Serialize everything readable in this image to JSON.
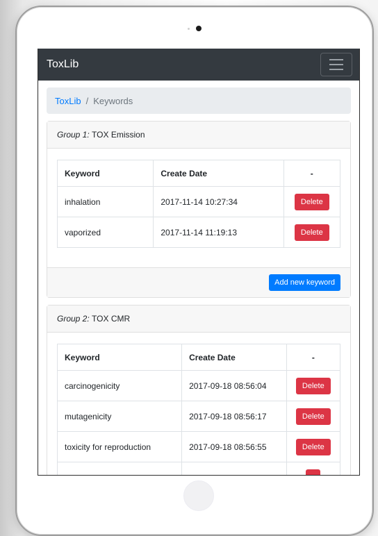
{
  "navbar": {
    "brand": "ToxLib",
    "toggle_icon": "hamburger-icon"
  },
  "breadcrumb": {
    "root": "ToxLib",
    "separator": "/",
    "current": "Keywords"
  },
  "groups": [
    {
      "label_prefix": "Group 1:",
      "name": "TOX Emission",
      "columns": [
        "Keyword",
        "Create Date",
        "-"
      ],
      "rows": [
        {
          "keyword": "inhalation",
          "date": "2017-11-14 10:27:34",
          "action": "Delete"
        },
        {
          "keyword": "vaporized",
          "date": "2017-11-14 11:19:13",
          "action": "Delete"
        }
      ],
      "footer_button": "Add new keyword"
    },
    {
      "label_prefix": "Group 2:",
      "name": "TOX CMR",
      "columns": [
        "Keyword",
        "Create Date",
        "-"
      ],
      "rows": [
        {
          "keyword": "carcinogenicity",
          "date": "2017-09-18 08:56:04",
          "action": "Delete"
        },
        {
          "keyword": "mutagenicity",
          "date": "2017-09-18 08:56:17",
          "action": "Delete"
        },
        {
          "keyword": "toxicity for reproduction",
          "date": "2017-09-18 08:56:55",
          "action": "Delete"
        }
      ]
    }
  ],
  "colors": {
    "navbar": "#343a40",
    "danger": "#dc3545",
    "primary": "#007bff",
    "link": "#007bff"
  }
}
